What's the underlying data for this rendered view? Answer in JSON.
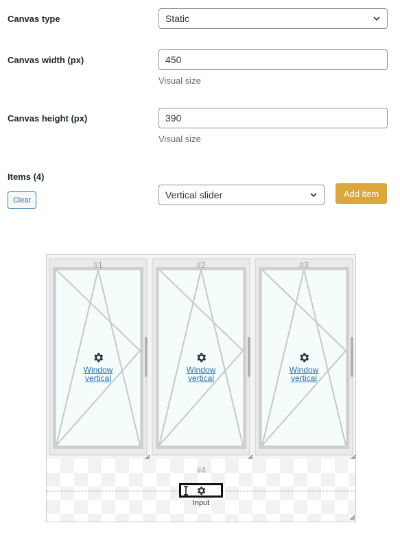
{
  "form": {
    "canvas_type": {
      "label": "Canvas type",
      "value": "Static"
    },
    "canvas_width": {
      "label": "Canvas width (px)",
      "value": "450",
      "hint": "Visual size"
    },
    "canvas_height": {
      "label": "Canvas height (px)",
      "value": "390",
      "hint": "Visual size"
    },
    "items": {
      "label": "Items (4)",
      "clear_label": "Clear",
      "item_type": "Vertical slider",
      "add_label": "Add item"
    }
  },
  "canvas": {
    "windows": [
      {
        "number": "#1",
        "label_line1": "Window",
        "label_line2": "vertical"
      },
      {
        "number": "#2",
        "label_line1": "Window",
        "label_line2": "vertical"
      },
      {
        "number": "#3",
        "label_line1": "Window",
        "label_line2": "vertical"
      }
    ],
    "input_item": {
      "number": "#4",
      "label": "Input"
    }
  },
  "colors": {
    "primary": "#2271b1",
    "add_button": "#dba73a",
    "glass": "#f5fcfc"
  },
  "icons": {
    "dropdown": "chevron-down-icon",
    "settings": "gear-icon",
    "text_cursor": "text-cursor-icon",
    "resize": "resize-grip-icon"
  }
}
